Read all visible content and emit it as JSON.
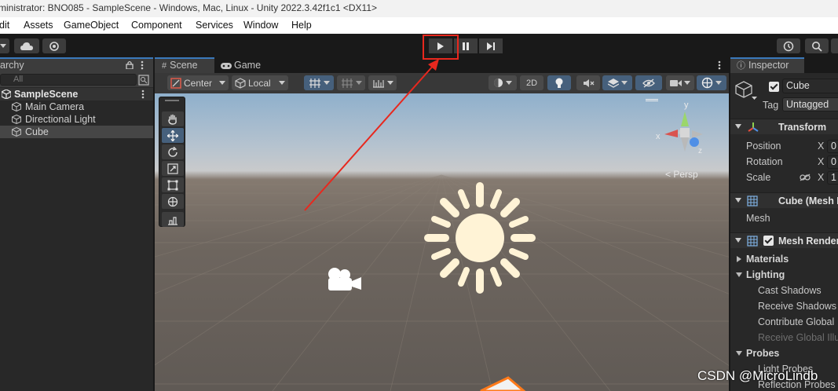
{
  "window": {
    "title": "ministrator: BNO085 - SampleScene - Windows, Mac, Linux - Unity 2022.3.42f1c1 <DX11>"
  },
  "menu": {
    "items": [
      "dit",
      "Assets",
      "GameObject",
      "Component",
      "Services",
      "Window",
      "Help"
    ]
  },
  "hierarchy": {
    "tab_label": "archy",
    "search_placeholder": "All",
    "scene_name": "SampleScene",
    "items": [
      "Main Camera",
      "Directional Light",
      "Cube"
    ]
  },
  "scene": {
    "tabs": [
      "Scene",
      "Game"
    ],
    "pivot_mode": "Center",
    "pivot_rotation": "Local",
    "mode_2d": "2D",
    "persp_label": "< Persp",
    "gizmo_axes": {
      "y": "y",
      "z": "z"
    }
  },
  "inspector": {
    "tab_label": "Inspector",
    "object_name": "Cube",
    "tag_label": "Tag",
    "tag_value": "Untagged",
    "components": {
      "transform": "Transform",
      "mesh_filter": "Cube (Mesh F",
      "mesh_filter_field": "Mesh",
      "mesh_renderer": "Mesh Render"
    },
    "transform_fields": [
      {
        "label": "Position",
        "axis": "X",
        "value": "0"
      },
      {
        "label": "Rotation",
        "axis": "X",
        "value": "0"
      },
      {
        "label": "Scale",
        "axis": "X",
        "value": "1"
      }
    ],
    "sections": [
      "Materials",
      "Lighting",
      "Probes"
    ],
    "lighting_items": [
      "Cast Shadows",
      "Receive Shadows",
      "Contribute Global",
      "Receive Global Illu"
    ],
    "probe_items": [
      "Light Probes",
      "Reflection Probes"
    ]
  },
  "watermark": "CSDN @MicroLindb",
  "colors": {
    "annotation_red": "#e8281e",
    "accent_blue": "#3a79bb",
    "sun": "#fff3d6"
  }
}
